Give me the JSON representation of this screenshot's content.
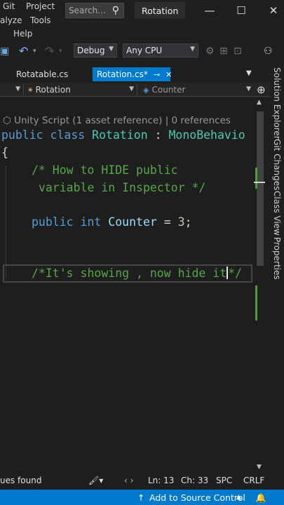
{
  "menu": {
    "row1": [
      "Git",
      "Project"
    ],
    "row2": [
      "alyze",
      "Tools"
    ],
    "row3": [
      "Help"
    ]
  },
  "search": {
    "placeholder": "Search..."
  },
  "app_title": "Rotation",
  "toolbar": {
    "config": "Debug",
    "platform": "Any CPU"
  },
  "tabs": [
    {
      "label": "Rotatable.cs",
      "active": false
    },
    {
      "label": "Rotation.cs*",
      "active": true
    }
  ],
  "navbar": {
    "class_dropdown": "Rotation",
    "member_dropdown": "Counter"
  },
  "editor": {
    "codelens": "Unity Script (1 asset reference) | 0 references",
    "lines": {
      "class_kw1": "public",
      "class_kw2": "class",
      "class_name": "Rotation",
      "class_colon": " : ",
      "class_base": "MonoBehavio",
      "brace": "{",
      "comment1a": "/* How to HIDE public",
      "comment1b": " variable in Inspector */",
      "field_kw1": "public",
      "field_kw2": "int",
      "field_name": "Counter",
      "field_eq": " = ",
      "field_val": "3",
      "field_semi": ";",
      "comment2a": "/*It's showing , now hide it",
      "comment2b": "*/"
    }
  },
  "side_tabs": [
    "Solution Explorer",
    "Git Changes",
    "Class View",
    "Properties"
  ],
  "info_bar": {
    "issues": "ues found",
    "line": "Ln: 13",
    "col": "Ch: 33",
    "spc": "SPC",
    "crlf": "CRLF"
  },
  "status_bar": {
    "source_control": "Add to Source Control"
  },
  "colors": {
    "accent": "#007acc",
    "keyword": "#569cd6",
    "type": "#4ec9b0",
    "comment": "#57a64a"
  }
}
